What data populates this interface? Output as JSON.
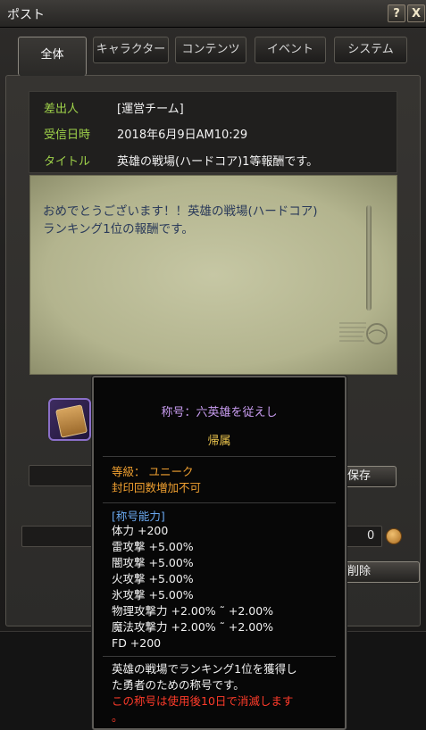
{
  "window": {
    "title": "ポスト",
    "help_glyph": "?",
    "close_glyph": "X"
  },
  "tabs": [
    {
      "label": "全体",
      "active": true
    },
    {
      "label": "キャラクター",
      "active": false
    },
    {
      "label": "コンテンツ",
      "active": false
    },
    {
      "label": "イベント",
      "active": false
    },
    {
      "label": "システム",
      "active": false
    }
  ],
  "mail": {
    "sender_label": "差出人",
    "sender": "[運営チーム]",
    "date_label": "受信日時",
    "date": "2018年6月9日AM10:29",
    "title_label": "タイトル",
    "title": "英雄の戦場(ハードコア)1等報酬です。",
    "body_line1": "おめでとうございます！！英雄の戦場(ハードコア)",
    "body_line2": "ランキング1位の報酬です。"
  },
  "actions": {
    "save_label": "保存",
    "delete_label": "削除",
    "gold_count": "0"
  },
  "tooltip": {
    "title": "称号：六英雄を従えし",
    "belonging": "帰属",
    "grade": "等級： ユニーク",
    "seal": "封印回数増加不可",
    "ability_header": "[称号能力]",
    "stats": [
      "体力 +200",
      "雷攻撃 +5.00%",
      "闇攻撃 +5.00%",
      "火攻撃 +5.00%",
      "氷攻撃 +5.00%",
      "物理攻撃力 +2.00% ˜ +2.00%",
      "魔法攻撃力 +2.00% ˜ +2.00%",
      "FD +200"
    ],
    "desc_line1": "英雄の戦場でランキング1位を獲得し",
    "desc_line2": "た勇者のための称号です。",
    "warn_line1": "この称号は使用後10日で消滅します",
    "warn_line2": "。"
  },
  "colors": {
    "label_green": "#9fd34a",
    "title_purple": "#c89cf0",
    "belong_gold": "#e8c24c",
    "seal_orange": "#f0a030",
    "ability_blue": "#6aa8f0",
    "warn_red": "#ff3b2a",
    "paper_text": "#2a3a5a"
  },
  "icons": {
    "help": "help-icon",
    "close": "close-icon",
    "reward_item": "title-scroll-item-icon",
    "gold": "gold-coin-icon"
  }
}
